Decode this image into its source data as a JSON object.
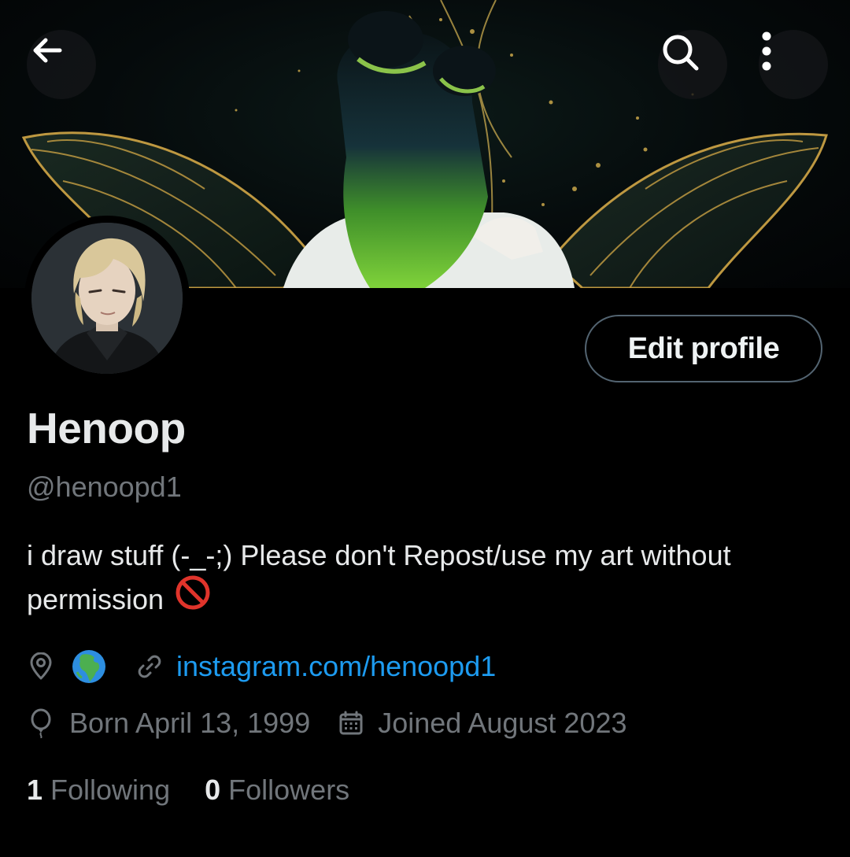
{
  "header": {
    "back_icon": "arrow-left-icon",
    "search_icon": "search-icon",
    "more_icon": "more-vertical-icon"
  },
  "profile": {
    "display_name": "Henoop",
    "handle": "@henoopd1",
    "bio_text": "i draw stuff (-_-;) Please don't Repost/use my art without permission",
    "bio_emoji": "no-entry-sign-icon",
    "edit_button_label": "Edit profile",
    "location_icon": "location-pin-icon",
    "location_emoji": "globe-africa-europe-icon",
    "link_icon": "link-icon",
    "website": "instagram.com/henoopd1",
    "birthday_icon": "balloon-icon",
    "birthday": "Born April 13, 1999",
    "joined_icon": "calendar-icon",
    "joined": "Joined August 2023"
  },
  "stats": {
    "following_count": "1",
    "following_label": "Following",
    "followers_count": "0",
    "followers_label": "Followers"
  },
  "colors": {
    "background": "#000000",
    "link": "#1d9bf0",
    "secondary_text": "#71767b",
    "primary_text": "#e7e9ea",
    "button_border": "#536471"
  }
}
